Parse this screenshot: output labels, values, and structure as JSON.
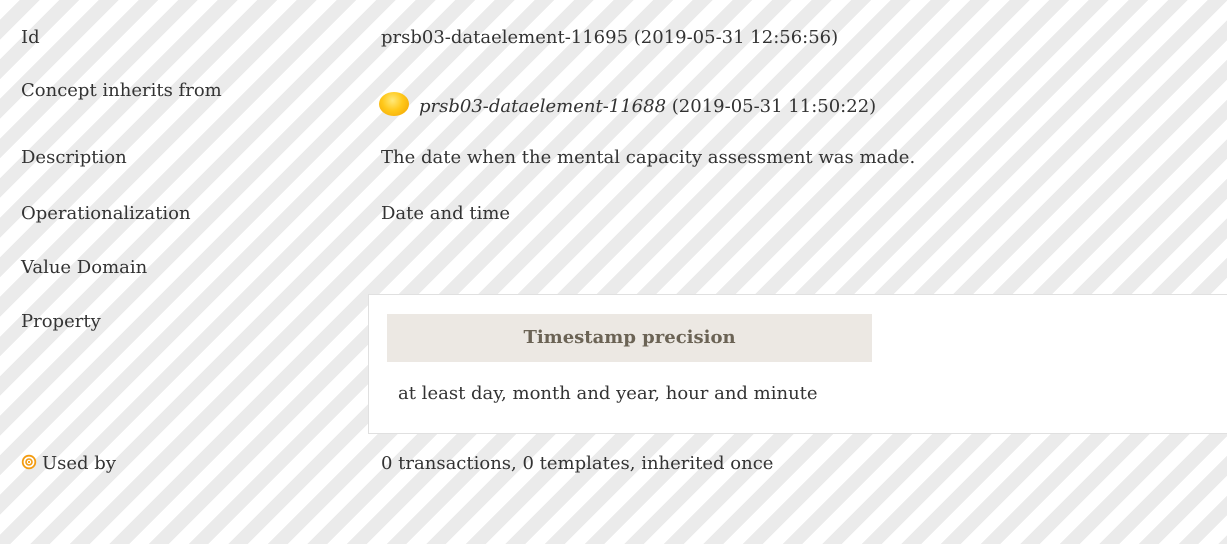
{
  "rows": {
    "id": {
      "label": "Id",
      "value": "prsb03-dataelement-11695 (2019-05-31 12:56:56)"
    },
    "inherits": {
      "label": "Concept inherits from",
      "link": "prsb03-dataelement-11688",
      "date": "(2019-05-31 11:50:22)",
      "icon": "status-ball-icon"
    },
    "description": {
      "label": "Description",
      "value": "The date when the mental capacity assessment was made."
    },
    "operationalization": {
      "label": "Operationalization",
      "value": "Date and time"
    },
    "value_domain": {
      "label": "Value Domain"
    },
    "property": {
      "label": "Property",
      "header": "Timestamp precision",
      "value": "at least day, month and year, hour and minute"
    },
    "used_by": {
      "label": "Used by",
      "value": "0 transactions, 0 templates, inherited once",
      "icon": "target-icon"
    }
  },
  "colors": {
    "ball_accent": "#ffc81a",
    "target_accent": "#f39c12",
    "property_header_bg": "#ece8e3"
  }
}
